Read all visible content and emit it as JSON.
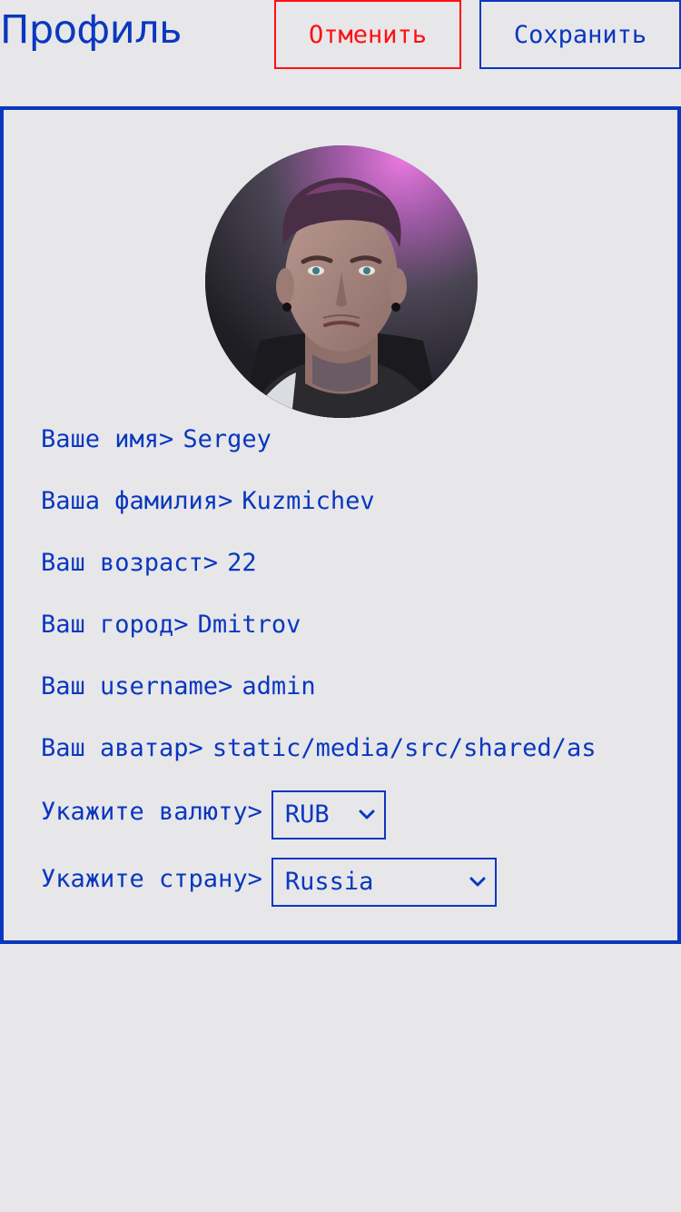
{
  "header": {
    "title": "Профиль",
    "cancel_label": "Отменить",
    "save_label": "Сохранить"
  },
  "profile": {
    "avatar_icon": "user-avatar-photo",
    "fields": [
      {
        "label": "Ваше имя>",
        "value": "Sergey"
      },
      {
        "label": "Ваша фамилия>",
        "value": "Kuzmichev"
      },
      {
        "label": "Ваш возраст>",
        "value": "22"
      },
      {
        "label": "Ваш город>",
        "value": "Dmitrov"
      },
      {
        "label": "Ваш username>",
        "value": "admin"
      },
      {
        "label": "Ваш аватар>",
        "value": "static/media/src/shared/as"
      }
    ],
    "currency": {
      "label": "Укажите валюту>",
      "selected": "RUB"
    },
    "country": {
      "label": "Укажите страну>",
      "selected": "Russia"
    }
  },
  "colors": {
    "accent": "#0a37bf",
    "danger": "#ff1010",
    "background": "#e7e7ea"
  }
}
